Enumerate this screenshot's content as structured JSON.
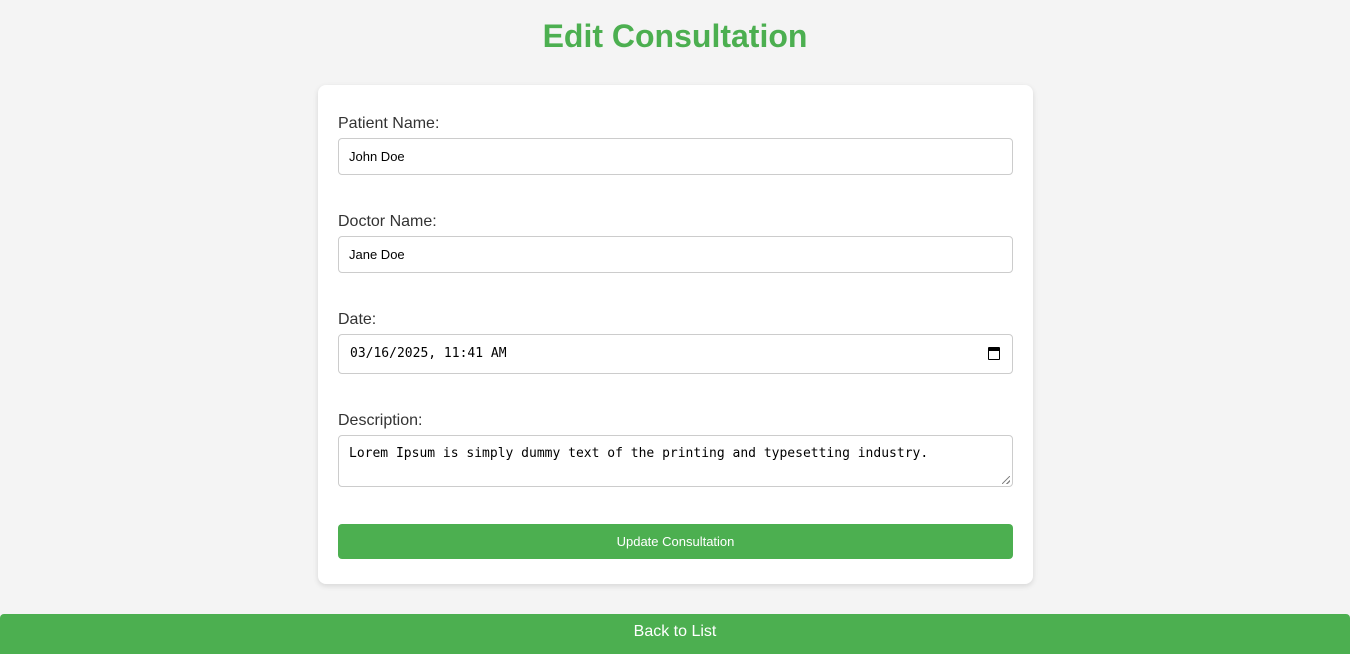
{
  "page": {
    "title": "Edit Consultation"
  },
  "form": {
    "patient_name": {
      "label": "Patient Name:",
      "value": "John Doe"
    },
    "doctor_name": {
      "label": "Doctor Name:",
      "value": "Jane Doe"
    },
    "date": {
      "label": "Date:",
      "value": "03/16/2025, 11:41 AM",
      "icon": "calendar-icon"
    },
    "description": {
      "label": "Description:",
      "value": "Lorem Ipsum is simply dummy text of the printing and typesetting industry."
    },
    "submit_label": "Update Consultation"
  },
  "nav": {
    "back_label": "Back to List"
  },
  "colors": {
    "accent": "#4caf50",
    "background": "#f4f4f4",
    "card": "#ffffff"
  }
}
